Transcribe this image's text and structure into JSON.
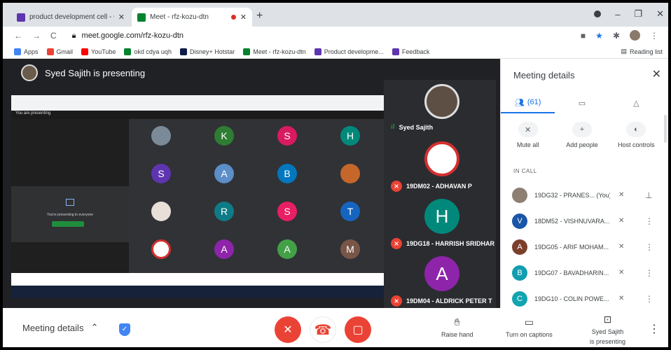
{
  "browser": {
    "tabs": [
      {
        "label": "product development cell - Goo",
        "active": false
      },
      {
        "label": "Meet - rfz-kozu-dtn",
        "active": true
      }
    ],
    "url": "meet.google.com/rfz-kozu-dtn",
    "bookmarks": [
      "Apps",
      "Gmail",
      "YouTube",
      "okd cdya uqh",
      "Disney+ Hotstar",
      "Meet - rfz-kozu-dtn",
      "Product developme...",
      "Feedback"
    ],
    "reading_list": "Reading list"
  },
  "meet": {
    "presenter_text": "Syed Sajith is presenting",
    "shared_screen": {
      "you_presenting": "You are presenting",
      "presenting_msg": "You're presenting to everyone",
      "grid_tiles": [
        "",
        "K",
        "S",
        "H",
        "S",
        "A",
        "B",
        "",
        "",
        "R",
        "S",
        "T",
        "",
        "A",
        "A",
        "M"
      ]
    },
    "participants_strip": [
      {
        "name": "Syed Sajith",
        "initial": "",
        "speaking": true
      },
      {
        "name": "19DM02 - ADHAVAN P",
        "initial": "",
        "muted": true
      },
      {
        "name": "19DG18 - HARRISH SRIDHAR",
        "initial": "H",
        "muted": true
      },
      {
        "name": "19DM04 - ALDRICK PETER T",
        "initial": "A",
        "muted": true
      }
    ]
  },
  "controls": {
    "meeting_details": "Meeting details",
    "raise_hand": "Raise hand",
    "captions": "Turn on captions",
    "presenting_line1": "Syed Sajith",
    "presenting_line2": "is presenting"
  },
  "side_panel": {
    "title": "Meeting details",
    "people_count": "(61)",
    "actions": [
      "Mute all",
      "Add people",
      "Host controls"
    ],
    "in_call_label": "IN CALL",
    "people": [
      {
        "initial": "",
        "name": "19DG32 - PRANES... (You)",
        "color": "#8d7f72"
      },
      {
        "initial": "V",
        "name": "18DM52 - VISHNUVARA...",
        "color": "#1a56a8"
      },
      {
        "initial": "A",
        "name": "19DG05 - ARIF MOHAM...",
        "color": "#7b3f2c"
      },
      {
        "initial": "B",
        "name": "19DG07 - BAVADHARIN...",
        "color": "#129eaf"
      },
      {
        "initial": "C",
        "name": "19DG10 - COLIN POWE...",
        "color": "#12a4af"
      }
    ]
  }
}
